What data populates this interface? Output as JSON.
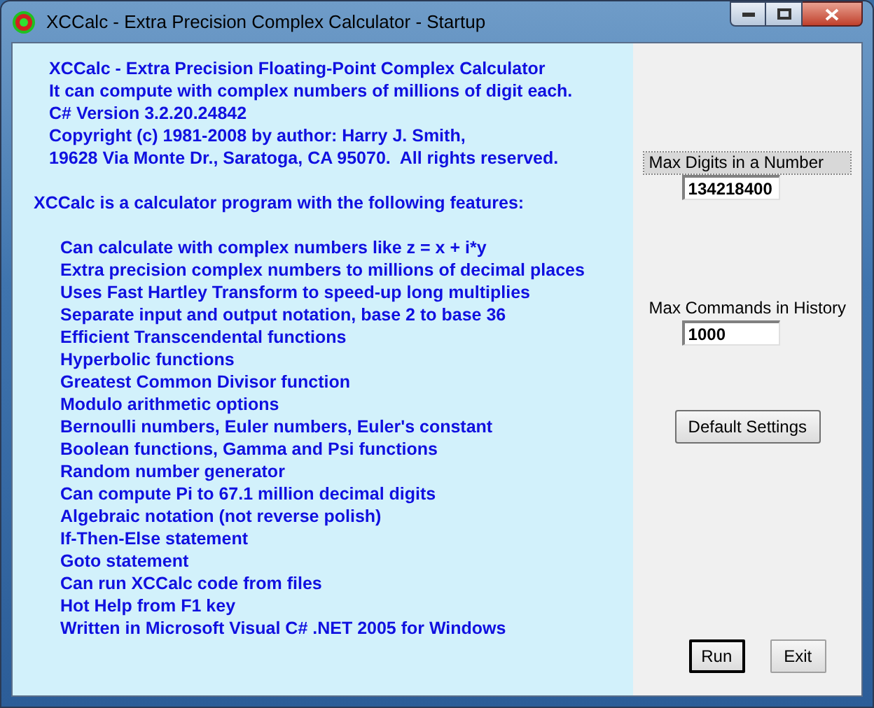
{
  "window": {
    "title": "XCCalc - Extra Precision Complex Calculator - Startup"
  },
  "header_lines": [
    "XCCalc - Extra Precision Floating-Point Complex Calculator",
    "It can compute with complex numbers of millions of digit each.",
    "C# Version 3.2.20.24842",
    "Copyright (c) 1981-2008 by author: Harry J. Smith,",
    "19628 Via Monte Dr., Saratoga, CA 95070.  All rights reserved."
  ],
  "intro": "XCCalc is a calculator program with the following features:",
  "features": [
    "Can calculate with complex numbers like z = x + i*y",
    "Extra precision complex numbers to millions of decimal places",
    "Uses Fast Hartley Transform to speed-up long multiplies",
    "Separate input and output notation, base 2 to base 36",
    "Efficient Transcendental functions",
    "Hyperbolic functions",
    "Greatest Common Divisor function",
    "Modulo arithmetic options",
    "Bernoulli numbers, Euler numbers, Euler's constant",
    "Boolean functions, Gamma and Psi functions",
    "Random number generator",
    "Can compute Pi to 67.1 million decimal digits",
    "Algebraic notation (not reverse polish)",
    "If-Then-Else statement",
    "Goto statement",
    "Can run XCCalc code from files",
    "Hot Help from F1 key",
    "Written in Microsoft Visual C# .NET 2005 for Windows"
  ],
  "settings": [
    {
      "label": "Max Digits in a Number",
      "value": "134218400",
      "focused": true
    },
    {
      "label": "Max Commands in History",
      "value": "1000",
      "focused": false
    }
  ],
  "default_settings_button": "Default Settings",
  "buttons": [
    {
      "label": "Run",
      "default": true
    },
    {
      "label": "Exit",
      "default": false
    }
  ]
}
